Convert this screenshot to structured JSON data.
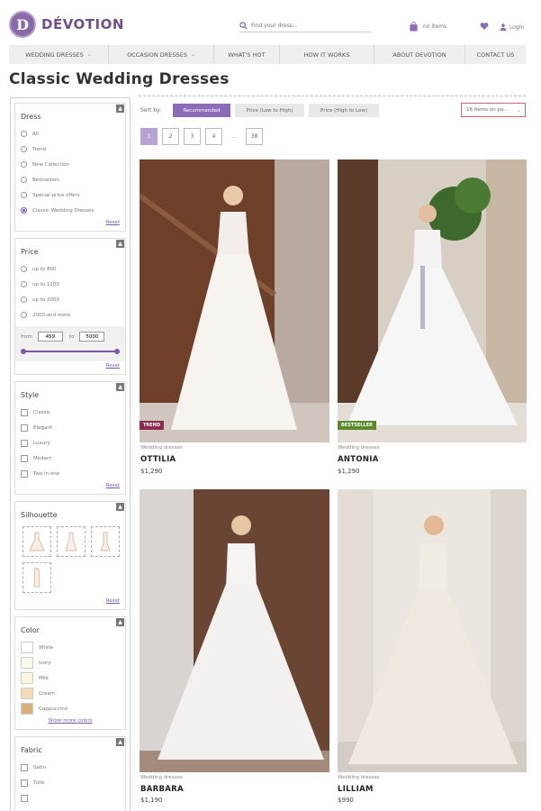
{
  "brand": {
    "name": "DÉVOTION",
    "mark": "D"
  },
  "search": {
    "placeholder": "Find your dress..."
  },
  "cart": {
    "label": "no items"
  },
  "account": {
    "label": "Login"
  },
  "nav": [
    {
      "label": "WEDDING DRESSES",
      "dropdown": true
    },
    {
      "label": "OCCASION DRESSES",
      "dropdown": true
    },
    {
      "label": "WHAT'S HOT",
      "dropdown": false
    },
    {
      "label": "HOW IT WORKS",
      "dropdown": false
    },
    {
      "label": "ABOUT DEVOTION",
      "dropdown": false
    },
    {
      "label": "CONTACT US",
      "dropdown": false
    }
  ],
  "page": {
    "title": "Classic Wedding Dresses"
  },
  "filters": {
    "dress": {
      "title": "Dress",
      "options": [
        "All",
        "Trend",
        "New Collection",
        "Bestsellers",
        "Special price offers",
        "Classic Wedding Dresses"
      ],
      "selected": 5,
      "reset": "Reset"
    },
    "price": {
      "title": "Price",
      "options": [
        "up to 800",
        "up to 1200",
        "up to 2000",
        "2000 and more"
      ],
      "from_label": "from",
      "to_label": "to",
      "from_value": "459",
      "to_value": "5000",
      "reset": "Reset"
    },
    "style": {
      "title": "Style",
      "options": [
        "Classic",
        "Elegant",
        "Luxury",
        "Modern",
        "Two in one"
      ],
      "reset": "Reset"
    },
    "silhouette": {
      "title": "Silhouette",
      "shapes": [
        "ball-gown-icon",
        "a-line-icon",
        "mermaid-icon",
        "sheath-icon"
      ],
      "reset": "Reset"
    },
    "color": {
      "title": "Color",
      "options": [
        {
          "label": "White",
          "hex": "#ffffff"
        },
        {
          "label": "Ivory",
          "hex": "#fbf8ea"
        },
        {
          "label": "Milk",
          "hex": "#fdf6dc"
        },
        {
          "label": "Cream",
          "hex": "#f3ddb7"
        },
        {
          "label": "Cappuccino",
          "hex": "#d7b07f"
        }
      ],
      "more": "Show more colors"
    },
    "fabric": {
      "title": "Fabric",
      "options": [
        "Satin",
        "Tulle"
      ]
    }
  },
  "sort": {
    "label": "Sort by:",
    "options": [
      "Recommended",
      "Price (Low to High)",
      "Price (High to Low)"
    ],
    "active": 0,
    "per_page": "16 items on pa..."
  },
  "pagination": {
    "pages": [
      "1",
      "2",
      "3",
      "4",
      "...",
      "38"
    ],
    "active": 0
  },
  "products": [
    {
      "category": "Wedding dresses",
      "name": "OTTILIA",
      "price": "$1,290",
      "badge": "TREND",
      "badge_color": "#8b2a4e"
    },
    {
      "category": "Wedding dresses",
      "name": "ANTONIA",
      "price": "$1,290",
      "badge": "BESTSELLER",
      "badge_color": "#5a8a2a"
    },
    {
      "category": "Wedding dresses",
      "name": "BARBARA",
      "price": "$1,190",
      "badge": "",
      "badge_color": ""
    },
    {
      "category": "Wedding dresses",
      "name": "LILLIAM",
      "price": "$990",
      "badge": "",
      "badge_color": ""
    }
  ],
  "colors": {
    "accent": "#8c6bb8",
    "brand": "#6e4f8e"
  }
}
